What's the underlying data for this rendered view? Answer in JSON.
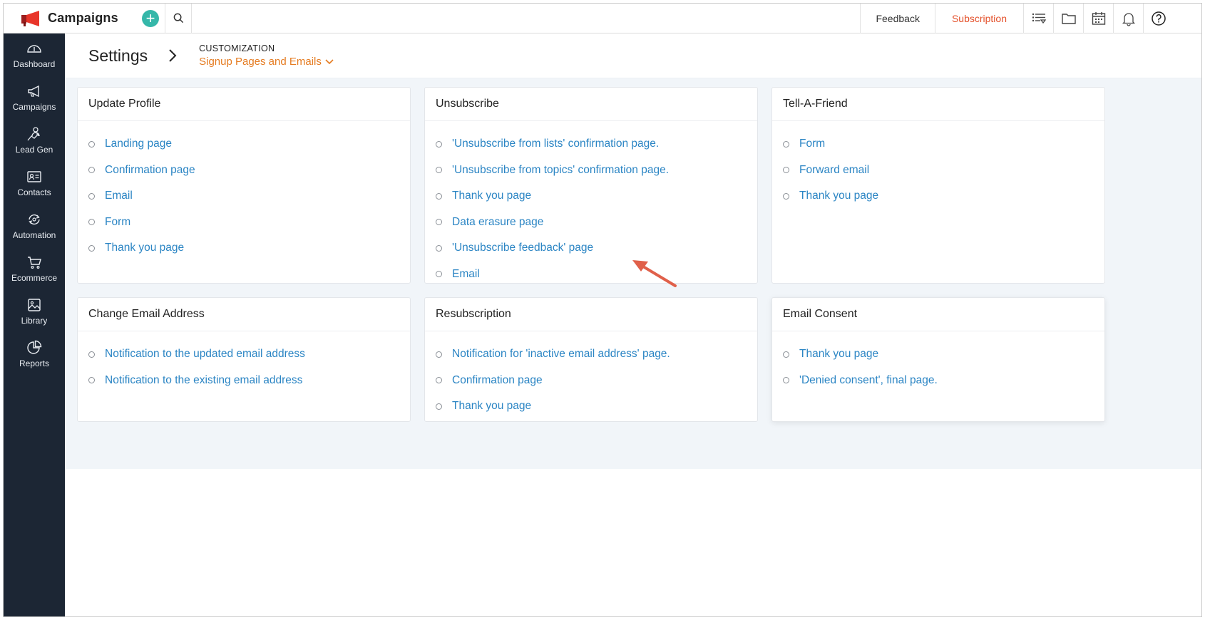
{
  "app": {
    "name": "Campaigns"
  },
  "topbar": {
    "feedback_label": "Feedback",
    "subscription_label": "Subscription",
    "icons": [
      "add-icon",
      "search-icon",
      "list-filter-icon",
      "folder-icon",
      "calendar-icon",
      "bell-icon",
      "help-icon"
    ],
    "subscription_color": "#e4512b"
  },
  "sidebar": {
    "items": [
      {
        "label": "Dashboard",
        "icon": "dashboard-icon"
      },
      {
        "label": "Campaigns",
        "icon": "megaphone-icon"
      },
      {
        "label": "Lead Gen",
        "icon": "lead-gen-icon"
      },
      {
        "label": "Contacts",
        "icon": "contact-card-icon"
      },
      {
        "label": "Automation",
        "icon": "automation-icon"
      },
      {
        "label": "Ecommerce",
        "icon": "cart-icon"
      },
      {
        "label": "Library",
        "icon": "image-library-icon"
      },
      {
        "label": "Reports",
        "icon": "pie-chart-icon"
      }
    ]
  },
  "header": {
    "title": "Settings",
    "crumb_section": "CUSTOMIZATION",
    "crumb_selected": "Signup Pages and Emails",
    "accent_color": "#e57b20"
  },
  "cards": [
    {
      "title": "Update Profile",
      "links": [
        "Landing page",
        "Confirmation page",
        "Email",
        "Form",
        "Thank you page"
      ]
    },
    {
      "title": "Unsubscribe",
      "links": [
        "'Unsubscribe from lists' confirmation page.",
        "'Unsubscribe from topics' confirmation page.",
        "Thank you page",
        "Data erasure page",
        "'Unsubscribe feedback' page",
        "Email"
      ]
    },
    {
      "title": "Tell-A-Friend",
      "links": [
        "Form",
        "Forward email",
        "Thank you page"
      ]
    },
    {
      "title": "Change Email Address",
      "links": [
        "Notification to the updated email address",
        "Notification to the existing email address"
      ]
    },
    {
      "title": "Resubscription",
      "links": [
        "Notification for 'inactive email address' page.",
        "Confirmation page",
        "Thank you page"
      ]
    },
    {
      "title": "Email Consent",
      "links": [
        "Thank you page",
        "'Denied consent', final page."
      ]
    }
  ],
  "link_color": "#2b85c4",
  "annotation_arrow_color": "#e0604a"
}
